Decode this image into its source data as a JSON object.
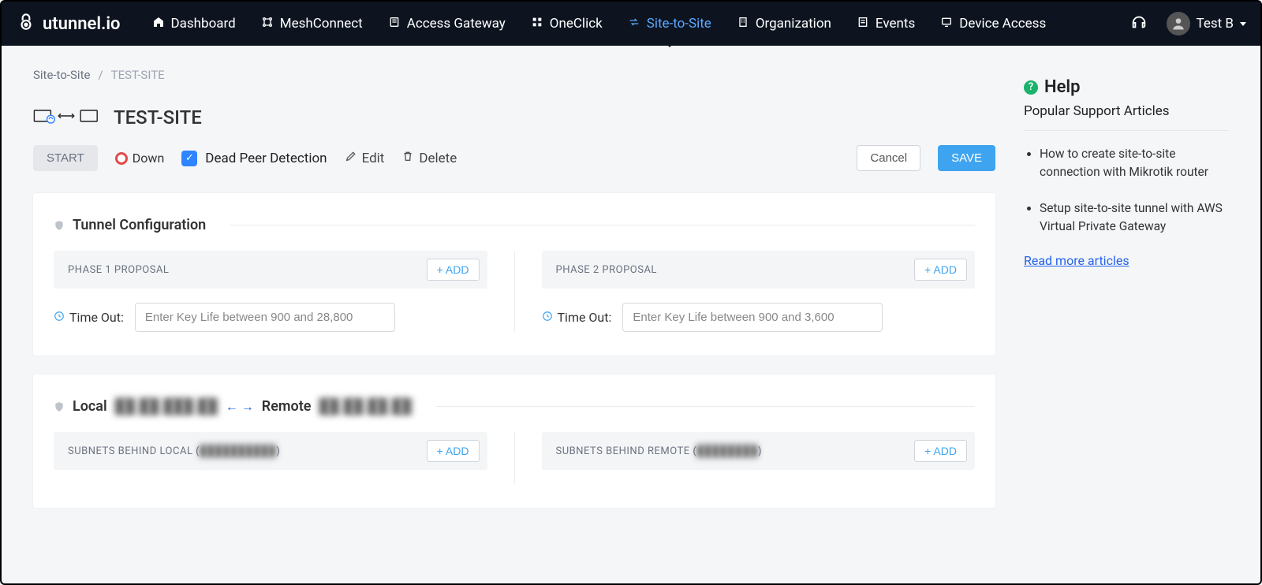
{
  "brand": "utunnel.io",
  "nav": {
    "items": [
      {
        "label": "Dashboard"
      },
      {
        "label": "MeshConnect"
      },
      {
        "label": "Access Gateway"
      },
      {
        "label": "OneClick"
      },
      {
        "label": "Site-to-Site",
        "active": true
      },
      {
        "label": "Organization"
      },
      {
        "label": "Events"
      },
      {
        "label": "Device Access"
      }
    ]
  },
  "user": {
    "name": "Test B"
  },
  "breadcrumb": {
    "root": "Site-to-Site",
    "current": "TEST-SITE"
  },
  "page_title": "TEST-SITE",
  "actions": {
    "start": "START",
    "status": "Down",
    "dpd": "Dead Peer Detection",
    "dpd_checked": true,
    "edit": "Edit",
    "delete": "Delete",
    "cancel": "Cancel",
    "save": "SAVE"
  },
  "tunnel": {
    "section_title": "Tunnel Configuration",
    "phase1": {
      "label": "PHASE 1 PROPOSAL",
      "add": "+ ADD",
      "timeout_label": "Time Out:",
      "placeholder": "Enter Key Life between 900 and 28,800",
      "value": ""
    },
    "phase2": {
      "label": "PHASE 2 PROPOSAL",
      "add": "+ ADD",
      "timeout_label": "Time Out:",
      "placeholder": "Enter Key Life between 900 and 3,600",
      "value": ""
    }
  },
  "endpoints": {
    "local_label": "Local",
    "local_ip": "██.██.███.██",
    "remote_label": "Remote",
    "remote_ip": "██.██.██.██",
    "subnets_local": {
      "label": "SUBNETS BEHIND LOCAL (",
      "ip": "██████████",
      "close": ")",
      "add": "+ ADD"
    },
    "subnets_remote": {
      "label": "SUBNETS BEHIND REMOTE (",
      "ip": "████████",
      "close": ")",
      "add": "+ ADD"
    }
  },
  "help": {
    "title": "Help",
    "subtitle": "Popular Support Articles",
    "articles": [
      "How to create site-to-site connection with Mikrotik router",
      "Setup site-to-site tunnel with AWS Virtual Private Gateway"
    ],
    "more": "Read more articles"
  }
}
